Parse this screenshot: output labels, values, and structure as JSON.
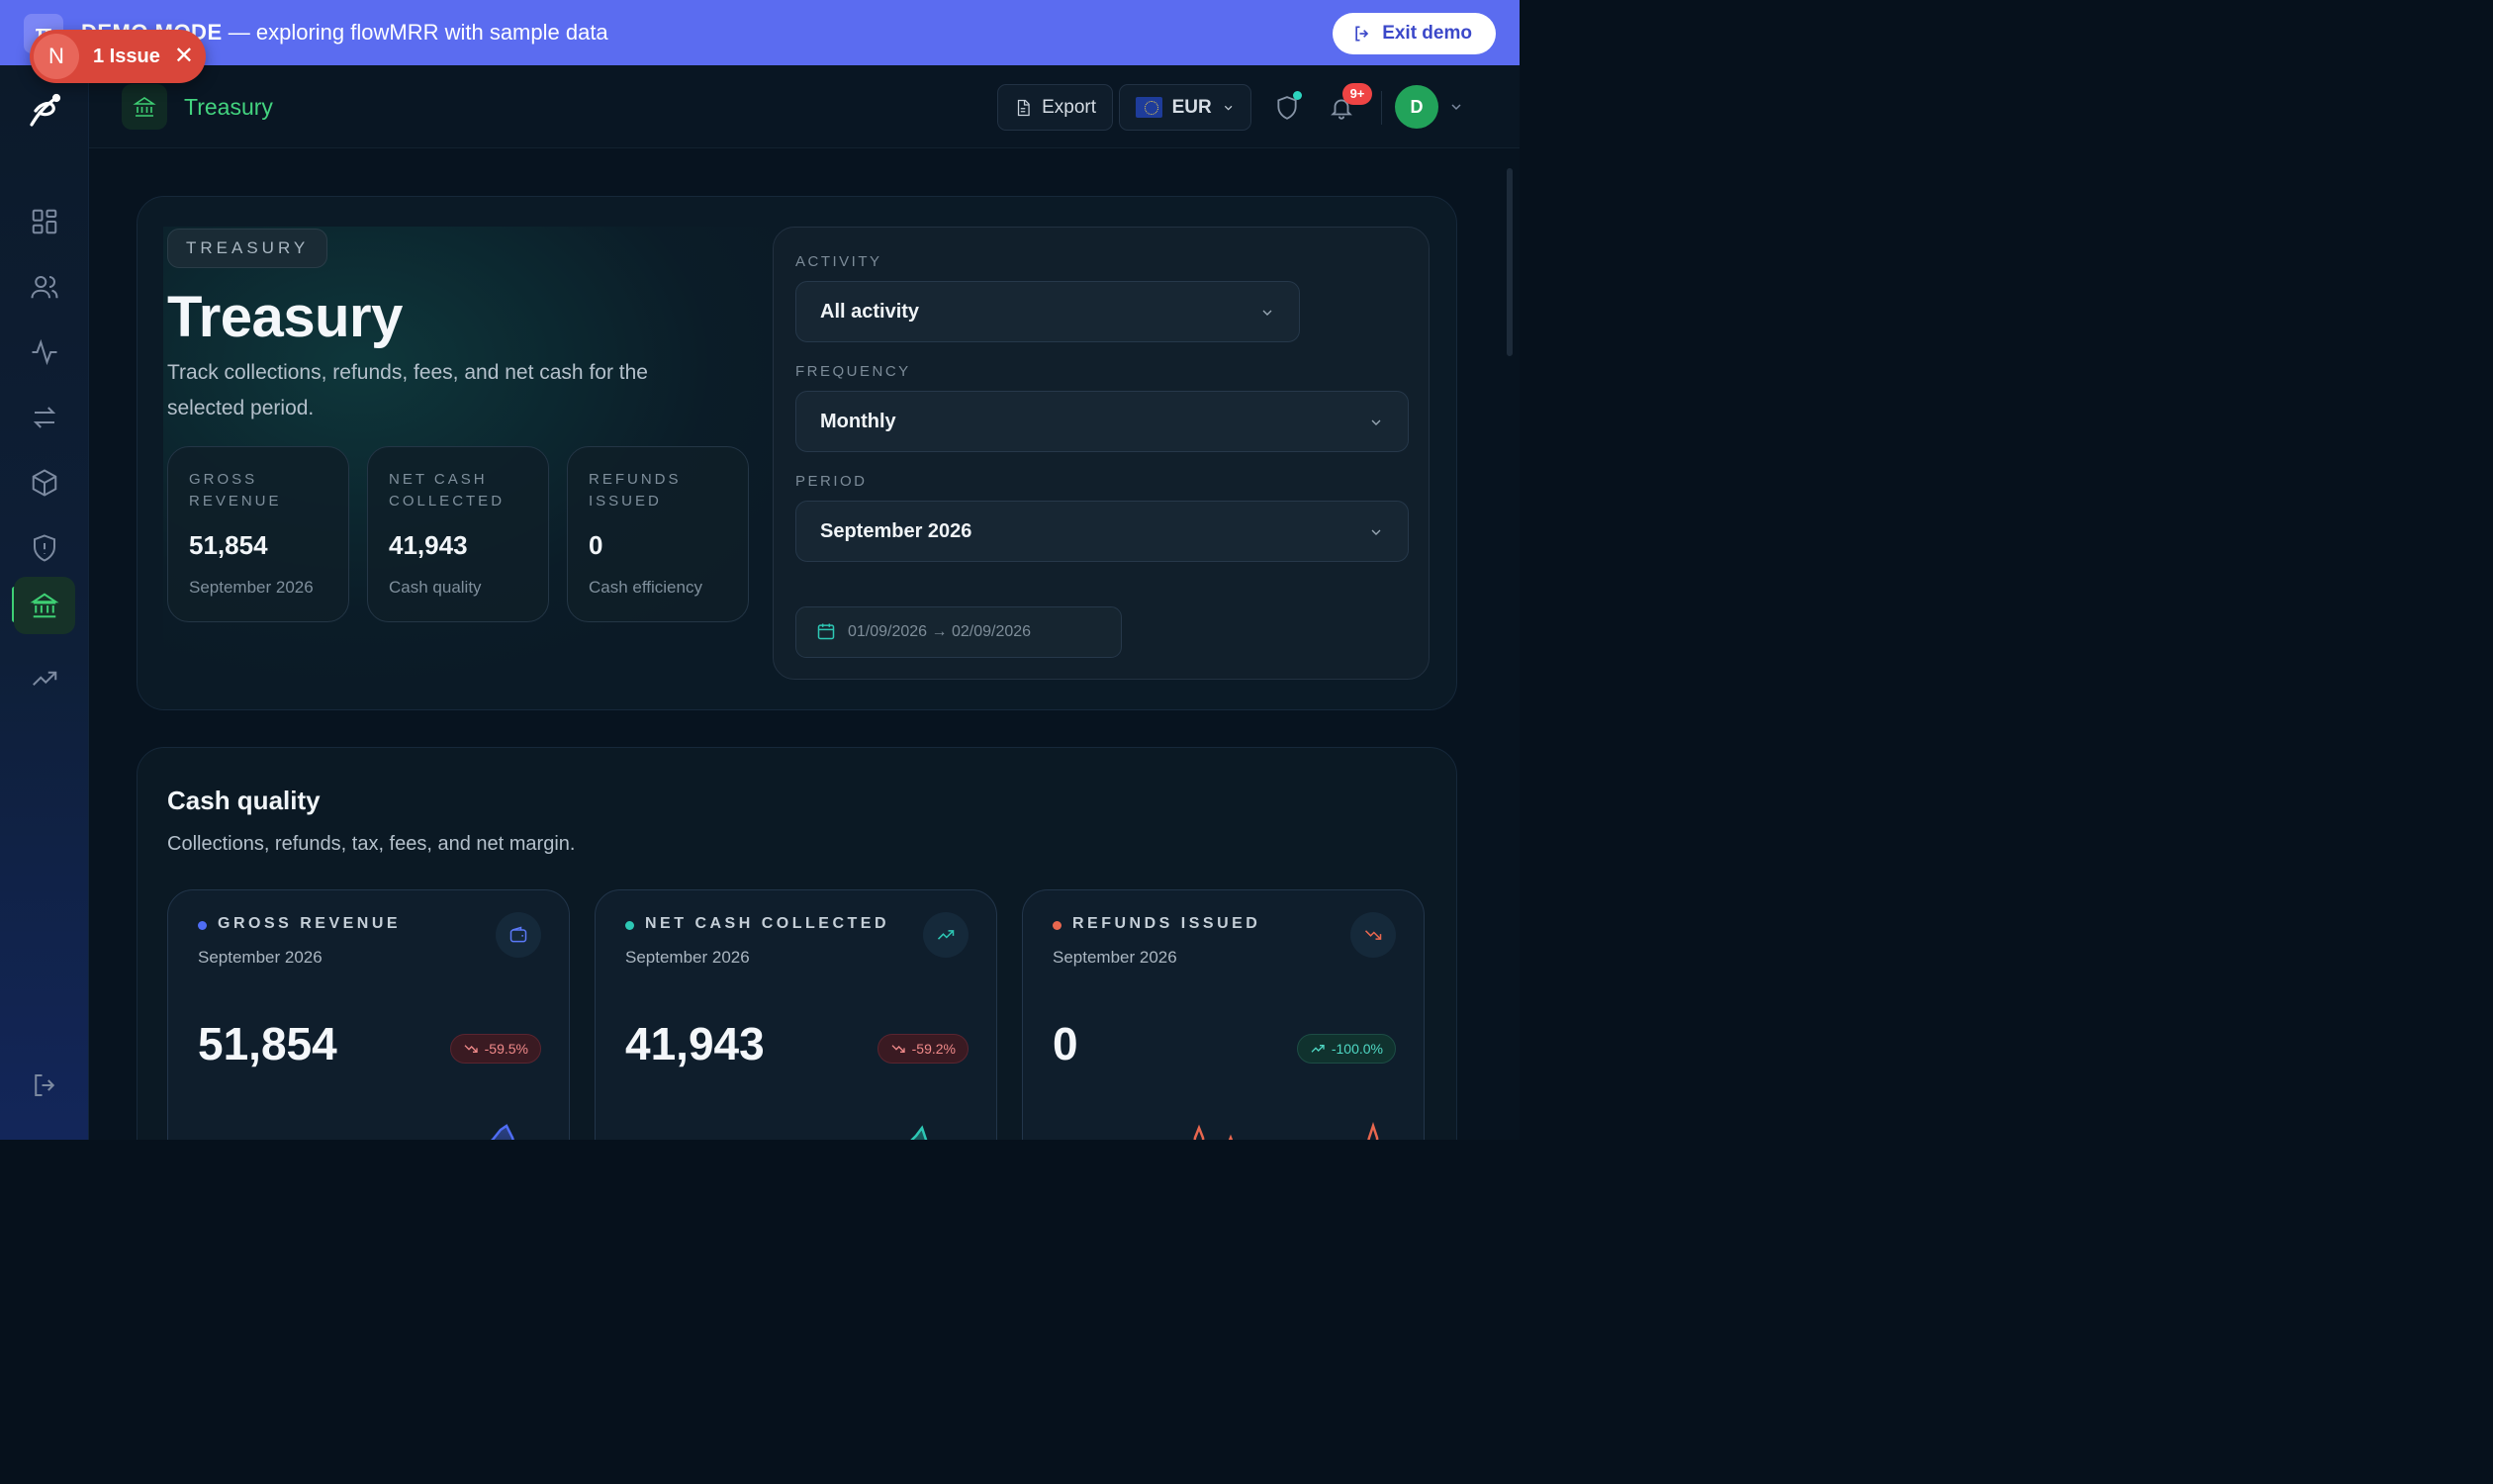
{
  "banner": {
    "badge": "π",
    "mode_label": "DEMO MODE",
    "text": " — exploring flowMRR with sample data",
    "exit_label": "Exit demo"
  },
  "issue_pill": {
    "badge": "N",
    "label": "1 Issue"
  },
  "topbar": {
    "page_title": "Treasury",
    "export_label": "Export",
    "currency": "EUR",
    "notifications_badge": "9+",
    "avatar_initial": "D"
  },
  "sidebar": {
    "items": [
      {
        "name": "dashboard",
        "icon": "grid-icon"
      },
      {
        "name": "customers",
        "icon": "users-icon"
      },
      {
        "name": "activity",
        "icon": "pulse-icon"
      },
      {
        "name": "transactions",
        "icon": "transfer-icon"
      },
      {
        "name": "products",
        "icon": "box-icon"
      },
      {
        "name": "security",
        "icon": "shield-icon"
      },
      {
        "name": "treasury",
        "icon": "bank-icon",
        "active": true
      },
      {
        "name": "growth",
        "icon": "trend-up-icon"
      }
    ],
    "logout_icon": "logout-icon"
  },
  "hero": {
    "tag": "TREASURY",
    "title": "Treasury",
    "description": "Track collections, refunds, fees, and net cash for the selected period.",
    "stats": [
      {
        "label": "GROSS REVENUE",
        "value": "51,854",
        "sub": "September 2026"
      },
      {
        "label": "NET CASH COLLECTED",
        "value": "41,943",
        "sub": "Cash quality"
      },
      {
        "label": "REFUNDS ISSUED",
        "value": "0",
        "sub": "Cash efficiency"
      }
    ]
  },
  "filters": {
    "activity_label": "ACTIVITY",
    "activity_value": "All activity",
    "frequency_label": "FREQUENCY",
    "frequency_value": "Monthly",
    "period_label": "PERIOD",
    "period_value": "September 2026",
    "date_range": "01/09/2026 → 02/09/2026"
  },
  "cash_quality": {
    "title": "Cash quality",
    "description": "Collections, refunds, tax, fees, and net margin.",
    "metrics": [
      {
        "label": "GROSS REVENUE",
        "period": "September 2026",
        "value": "51,854",
        "change": "-59.5%",
        "direction": "down",
        "color": "#4f6df5",
        "icon": "wallet-icon"
      },
      {
        "label": "NET CASH COLLECTED",
        "period": "September 2026",
        "value": "41,943",
        "change": "-59.2%",
        "direction": "down",
        "color": "#2dc7b4",
        "icon": "trend-up-icon"
      },
      {
        "label": "REFUNDS ISSUED",
        "period": "September 2026",
        "value": "0",
        "change": "-100.0%",
        "direction": "up",
        "color": "#e8674f",
        "icon": "trend-down-icon"
      }
    ]
  },
  "colors": {
    "banner": "#5b6cf0",
    "accent_green": "#3ecf74",
    "issue_red": "#d9463a"
  }
}
